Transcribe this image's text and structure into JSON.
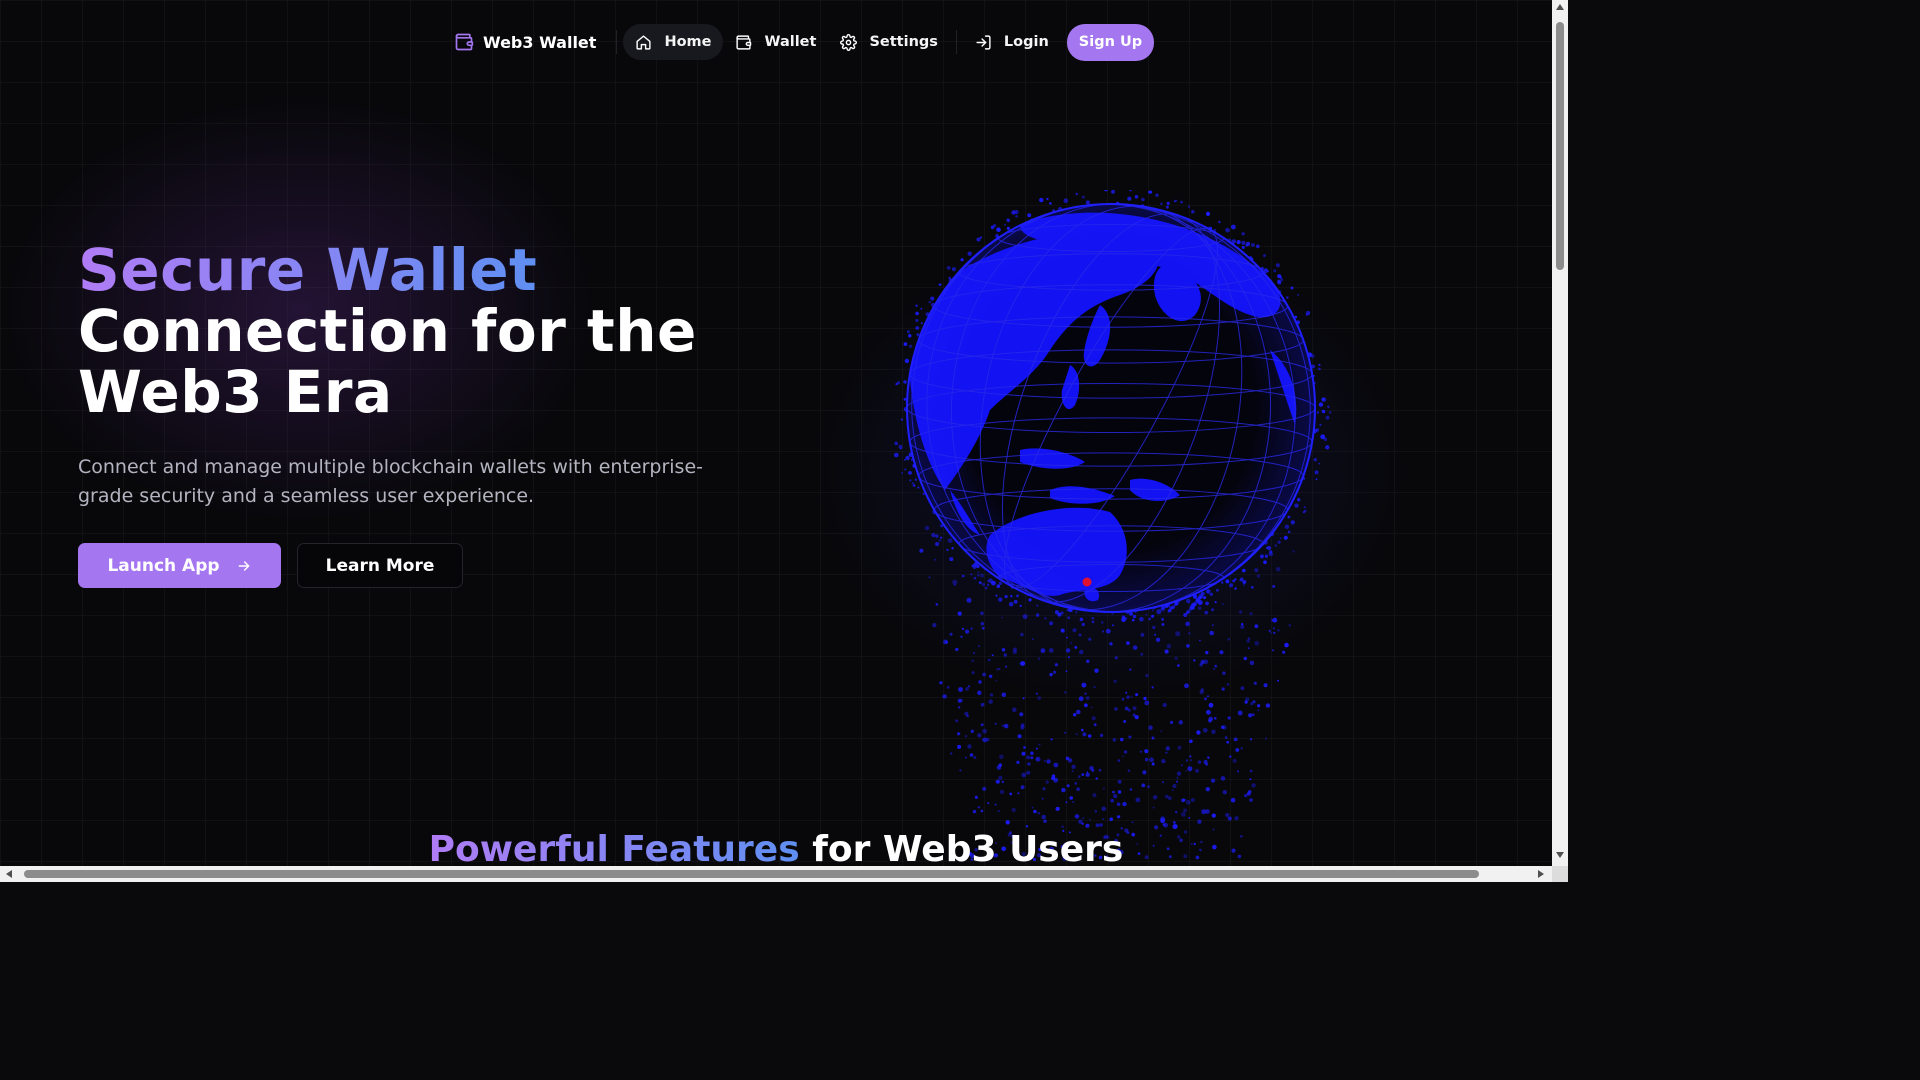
{
  "nav": {
    "brand": "Web3 Wallet",
    "items": [
      {
        "label": "Home",
        "icon": "home-icon",
        "active": true
      },
      {
        "label": "Wallet",
        "icon": "wallet-icon",
        "active": false
      },
      {
        "label": "Settings",
        "icon": "gear-icon",
        "active": false
      }
    ],
    "login": "Login",
    "signup": "Sign Up"
  },
  "hero": {
    "title_highlight": "Secure Wallet",
    "title_line2": "Connection for the",
    "title_line3": "Web3 Era",
    "subtitle": "Connect and manage multiple blockchain wallets with enterprise-grade security and a seamless user experience.",
    "primary_cta": "Launch App",
    "secondary_cta": "Learn More"
  },
  "globe": {
    "land_color": "#1010ee",
    "marker_color": "#e01030"
  },
  "features": {
    "title_highlight": "Powerful Features",
    "title_rest": "for Web3 Users"
  },
  "colors": {
    "accent": "#a476f0",
    "gradient_start": "#b07cf5",
    "gradient_end": "#5f8ff2",
    "background": "#08080b"
  }
}
